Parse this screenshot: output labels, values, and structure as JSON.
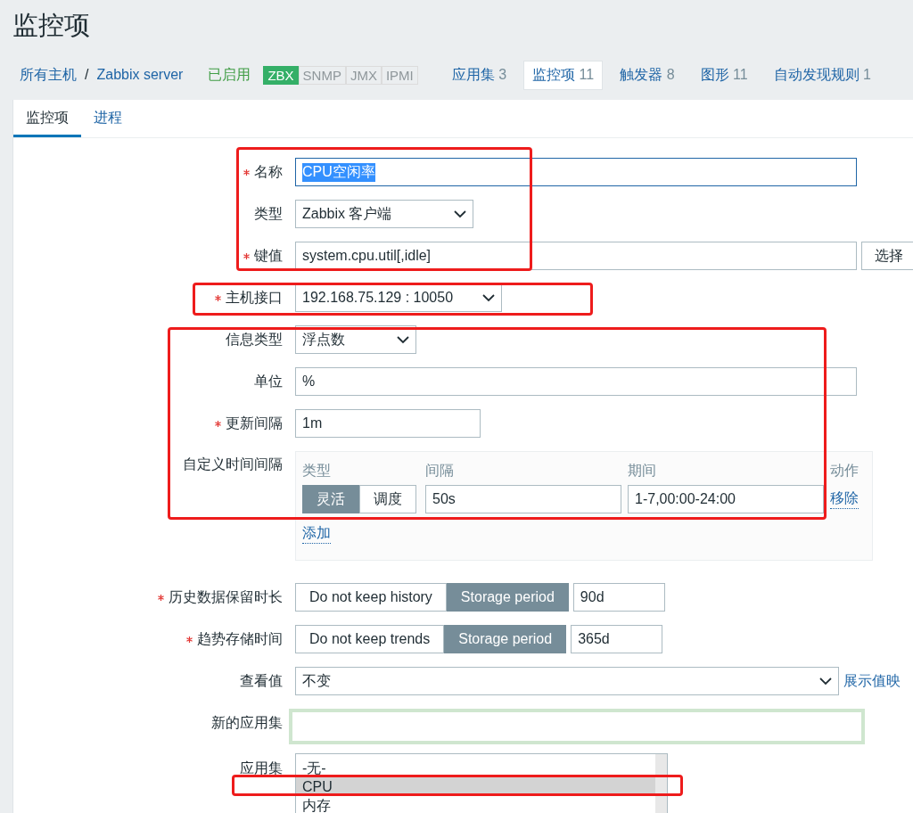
{
  "page_title": "监控项",
  "breadcrumb": [
    {
      "label": "所有主机"
    },
    {
      "label": "Zabbix server"
    }
  ],
  "breadcrumb_separator": "/",
  "status": "已启用",
  "availability": [
    {
      "label": "ZBX",
      "on": true
    },
    {
      "label": "SNMP",
      "on": false
    },
    {
      "label": "JMX",
      "on": false
    },
    {
      "label": "IPMI",
      "on": false
    }
  ],
  "host_tabs": [
    {
      "label": "应用集",
      "count": "3",
      "selected": false
    },
    {
      "label": "监控项",
      "count": "11",
      "selected": true
    },
    {
      "label": "触发器",
      "count": "8",
      "selected": false
    },
    {
      "label": "图形",
      "count": "11",
      "selected": false
    },
    {
      "label": "自动发现规则",
      "count": "1",
      "selected": false
    }
  ],
  "form_tabs": [
    {
      "label": "监控项",
      "selected": true
    },
    {
      "label": "进程",
      "selected": false
    }
  ],
  "fields": [
    {
      "kind": "text",
      "label": "名称",
      "required": true,
      "value": "CPU空闲率",
      "text_selected": true
    },
    {
      "kind": "select",
      "label": "类型",
      "required": false,
      "value": "Zabbix 客户端"
    },
    {
      "kind": "text_button",
      "label": "键值",
      "required": true,
      "value": "system.cpu.util[,idle]",
      "button": "选择"
    },
    {
      "kind": "select",
      "label": "主机接口",
      "required": true,
      "value": "192.168.75.129 : 10050"
    },
    {
      "kind": "select",
      "label": "信息类型",
      "required": false,
      "value": "浮点数"
    },
    {
      "kind": "text",
      "label": "单位",
      "required": false,
      "value": "%",
      "text_selected": false
    },
    {
      "kind": "text",
      "label": "更新间隔",
      "required": true,
      "value": "1m",
      "text_selected": false
    },
    {
      "kind": "intervals",
      "label": "自定义时间间隔",
      "required": false,
      "columns": [
        "类型",
        "间隔",
        "期间",
        "动作"
      ],
      "rows": [
        {
          "modes": [
            {
              "label": "灵活",
              "selected": true
            },
            {
              "label": "调度",
              "selected": false
            }
          ],
          "interval": "50s",
          "period": "1-7,00:00-24:00",
          "action": "移除"
        }
      ],
      "add": "添加"
    },
    {
      "kind": "storage",
      "label": "历史数据保留时长",
      "required": true,
      "options": [
        {
          "label": "Do not keep history",
          "selected": false
        },
        {
          "label": "Storage period",
          "selected": true
        }
      ],
      "value": "90d"
    },
    {
      "kind": "storage",
      "label": "趋势存储时间",
      "required": true,
      "options": [
        {
          "label": "Do not keep trends",
          "selected": false
        },
        {
          "label": "Storage period",
          "selected": true
        }
      ],
      "value": "365d"
    },
    {
      "kind": "select_link",
      "label": "查看值",
      "required": false,
      "value": "不变",
      "link": "展示值映"
    },
    {
      "kind": "new_text",
      "label": "新的应用集",
      "required": false,
      "highlighted": true
    },
    {
      "kind": "listbox",
      "label": "应用集",
      "required": false,
      "options": [
        {
          "label": "-无-",
          "selected": false
        },
        {
          "label": "CPU",
          "selected": true
        },
        {
          "label": "内存",
          "selected": false
        }
      ]
    }
  ]
}
